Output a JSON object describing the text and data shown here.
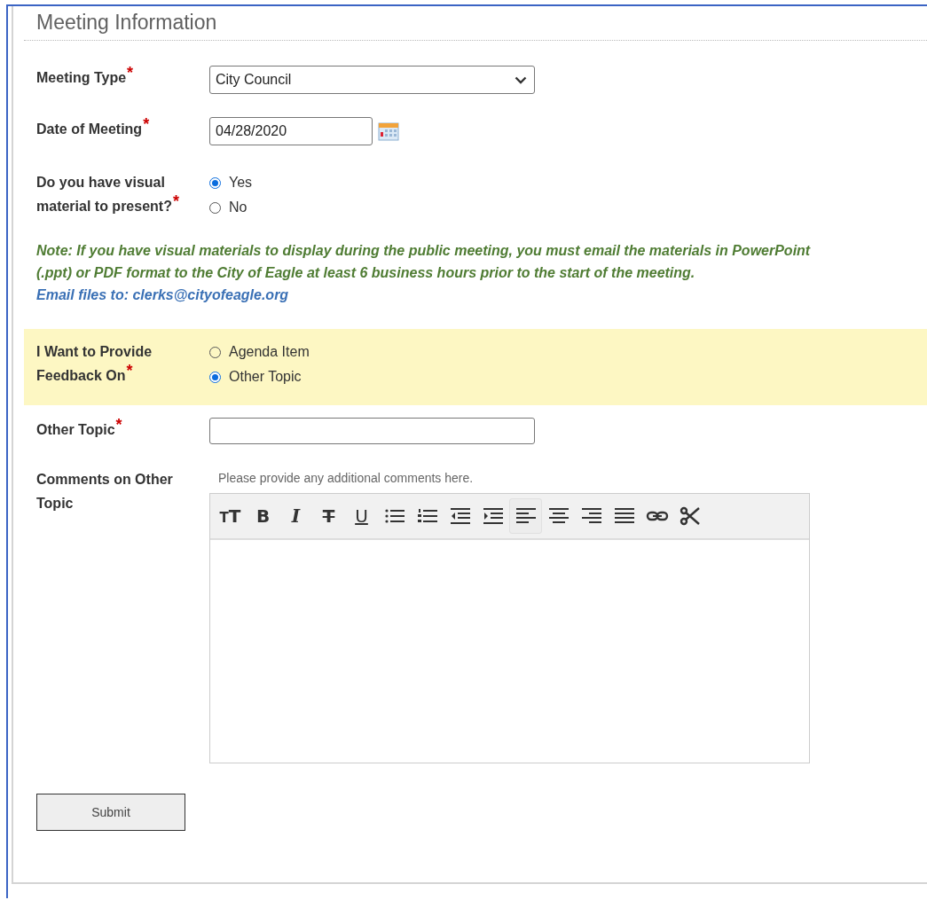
{
  "section": {
    "title": "Meeting Information"
  },
  "fields": [
    {
      "kind": "select",
      "label": "Meeting Type",
      "required_mark": "*",
      "value": "City Council"
    },
    {
      "kind": "date",
      "label": "Date of Meeting",
      "required_mark": "*",
      "value": "04/28/2020"
    },
    {
      "kind": "radio",
      "label": "Do you have visual material to present?",
      "required_mark": "*",
      "options": [
        {
          "label": "Yes",
          "selected": true
        },
        {
          "label": "No",
          "selected": false
        }
      ]
    },
    {
      "kind": "note",
      "text": "Note:  If you have visual materials to display during the public meeting, you must email the materials in PowerPoint (.ppt) or PDF format to the City of Eagle at least 6 business hours prior to the start of the meeting.",
      "email_line": "Email files to: clerks@cityofeagle.org"
    },
    {
      "kind": "radio",
      "highlighted": true,
      "label": "I Want to Provide Feedback On",
      "required_mark": "*",
      "options": [
        {
          "label": "Agenda Item",
          "selected": false
        },
        {
          "label": "Other Topic",
          "selected": true
        }
      ]
    },
    {
      "kind": "text",
      "label": "Other Topic",
      "required_mark": "*"
    },
    {
      "kind": "editor",
      "label": "Comments on Other Topic",
      "hint": "Please provide any additional comments here.",
      "toolbar": [
        {
          "kind": "text-size",
          "glyph": "TT",
          "active": false
        },
        {
          "kind": "bold",
          "glyph": "B",
          "active": false
        },
        {
          "kind": "italic",
          "glyph": "I",
          "active": false
        },
        {
          "kind": "strike",
          "glyph": "T",
          "active": false
        },
        {
          "kind": "underline",
          "glyph": "U",
          "active": false
        },
        {
          "kind": "bullets",
          "active": false
        },
        {
          "kind": "numbers",
          "active": false
        },
        {
          "kind": "outdent",
          "active": false
        },
        {
          "kind": "indent",
          "active": false
        },
        {
          "kind": "align-left",
          "active": true
        },
        {
          "kind": "align-center",
          "active": false
        },
        {
          "kind": "align-right",
          "active": false
        },
        {
          "kind": "justify",
          "active": false
        },
        {
          "kind": "link",
          "active": false
        },
        {
          "kind": "cut",
          "active": false
        }
      ]
    }
  ],
  "submit": "Submit"
}
